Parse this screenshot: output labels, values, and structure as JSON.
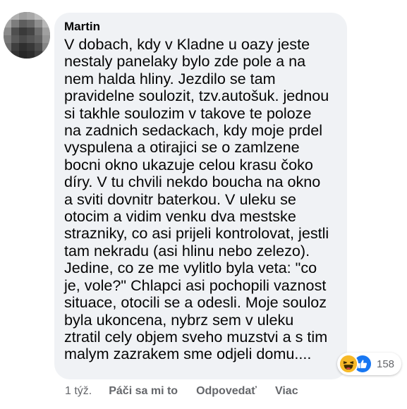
{
  "comment": {
    "author": "Martin",
    "text": "V dobach, kdy v Kladne u oazy jeste\nnestaly panelaky bylo zde pole a na\nnem halda hliny. Jezdilo se tam\npravidelne soulozit, tzv.autošuk. jednou\nsi takhle soulozim v takove te poloze\nna zadnich sedackach, kdy moje prdel\nvyspulena a otirajici se o zamlzene\nbocni okno ukazuje celou krasu čoko\ndíry. V tu chvili nekdo boucha na okno\na sviti dovnitr baterkou. V uleku se\notocim a vidim venku dva mestske\nstrazniky, co asi prijeli kontrolovat, jestli\ntam nekradu (asi hlinu nebo zelezo).\nJedine, co ze me vylitlo byla veta: \"co\nje, vole?\" Chlapci asi pochopili vaznost\nsituace, otocili se a odesli. Moje souloz\nbyla ukoncena, nybrz sem v uleku\nztratil cely objem sveho muzstvi a s tim\nmalym zazrakem sme odjeli domu....",
    "reactions": {
      "icons": [
        "haha-emoji-icon",
        "like-thumb-icon"
      ],
      "count": "158"
    }
  },
  "actions": {
    "time": "1 týž.",
    "like": "Páči sa mi to",
    "reply": "Odpovedať",
    "more": "Viac"
  },
  "colors": {
    "bubble": "#f0f2f5",
    "text": "#050505",
    "secondary": "#65676b",
    "like_blue": "#1877f2",
    "haha_yellow": "#f7b928"
  }
}
